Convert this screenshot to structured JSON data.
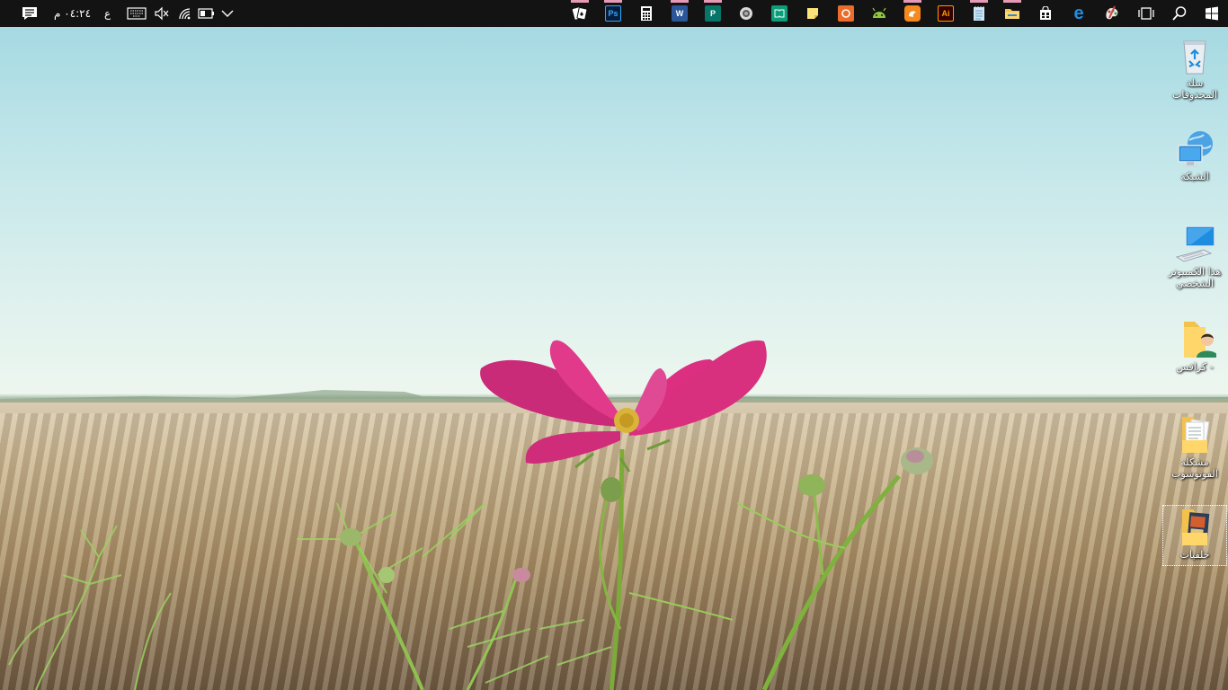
{
  "taskbar": {
    "clock": "٠٤:٢٤ م",
    "input_language": "ع",
    "notifications_icon": "action-center-icon",
    "tray": [
      "touch-keyboard-icon",
      "volume-muted-icon",
      "wifi-icon",
      "battery-icon",
      "show-hidden-icons-chevron"
    ],
    "pinned_apps": [
      {
        "name": "solitaire",
        "icon": "cards-icon",
        "label": "",
        "active": true
      },
      {
        "name": "photoshop",
        "icon": "photoshop-icon",
        "label": "Ps",
        "active": true
      },
      {
        "name": "calculator",
        "icon": "calculator-icon",
        "label": "",
        "active": false
      },
      {
        "name": "word",
        "icon": "word-icon",
        "label": "W",
        "active": true
      },
      {
        "name": "publisher",
        "icon": "publisher-icon",
        "label": "P",
        "active": true
      },
      {
        "name": "screenshot",
        "icon": "camera-icon",
        "label": "",
        "active": false
      },
      {
        "name": "reader",
        "icon": "book-icon",
        "label": "",
        "active": false
      },
      {
        "name": "sticky-notes",
        "icon": "sticky-notes-icon",
        "label": "",
        "active": false
      },
      {
        "name": "media",
        "icon": "orange-app-icon",
        "label": "",
        "active": false
      },
      {
        "name": "android",
        "icon": "android-icon",
        "label": "",
        "active": false
      },
      {
        "name": "uc-browser",
        "icon": "uc-browser-icon",
        "label": "",
        "active": true
      },
      {
        "name": "illustrator",
        "icon": "illustrator-icon",
        "label": "Ai",
        "active": false
      },
      {
        "name": "notepad",
        "icon": "notepad-icon",
        "label": "",
        "active": true
      },
      {
        "name": "file-explorer",
        "icon": "folder-icon",
        "label": "",
        "active": true
      },
      {
        "name": "store",
        "icon": "store-icon",
        "label": "",
        "active": false
      },
      {
        "name": "edge",
        "icon": "edge-icon",
        "label": "e",
        "active": false
      },
      {
        "name": "paint",
        "icon": "paint-icon",
        "label": "",
        "active": false
      }
    ],
    "task_view_icon": "task-view-icon",
    "search_icon": "search-icon",
    "start_icon": "windows-logo-icon"
  },
  "desktop": {
    "icons": [
      {
        "name": "recycle-bin",
        "icon": "recycle-bin-icon",
        "label": "سلة المحذوفات",
        "selected": false
      },
      {
        "name": "network",
        "icon": "network-icon",
        "label": "الشبكة",
        "selected": false
      },
      {
        "name": "this-pc",
        "icon": "computer-icon",
        "label": "هذا الكمبيوتر الشخصي",
        "selected": false
      },
      {
        "name": "user-folder",
        "icon": "user-folder-icon",
        "label": "- كرافس",
        "selected": false
      },
      {
        "name": "photoshop-issue",
        "icon": "documents-folder-icon",
        "label": "مشكلة الفوتوشوب",
        "selected": false
      },
      {
        "name": "wallpapers",
        "icon": "pictures-folder-icon",
        "label": "خلفيات",
        "selected": true
      }
    ]
  },
  "colors": {
    "taskbar_bg": "#131313",
    "active_indicator": "#e69ab6",
    "flower": "#d6307e"
  }
}
